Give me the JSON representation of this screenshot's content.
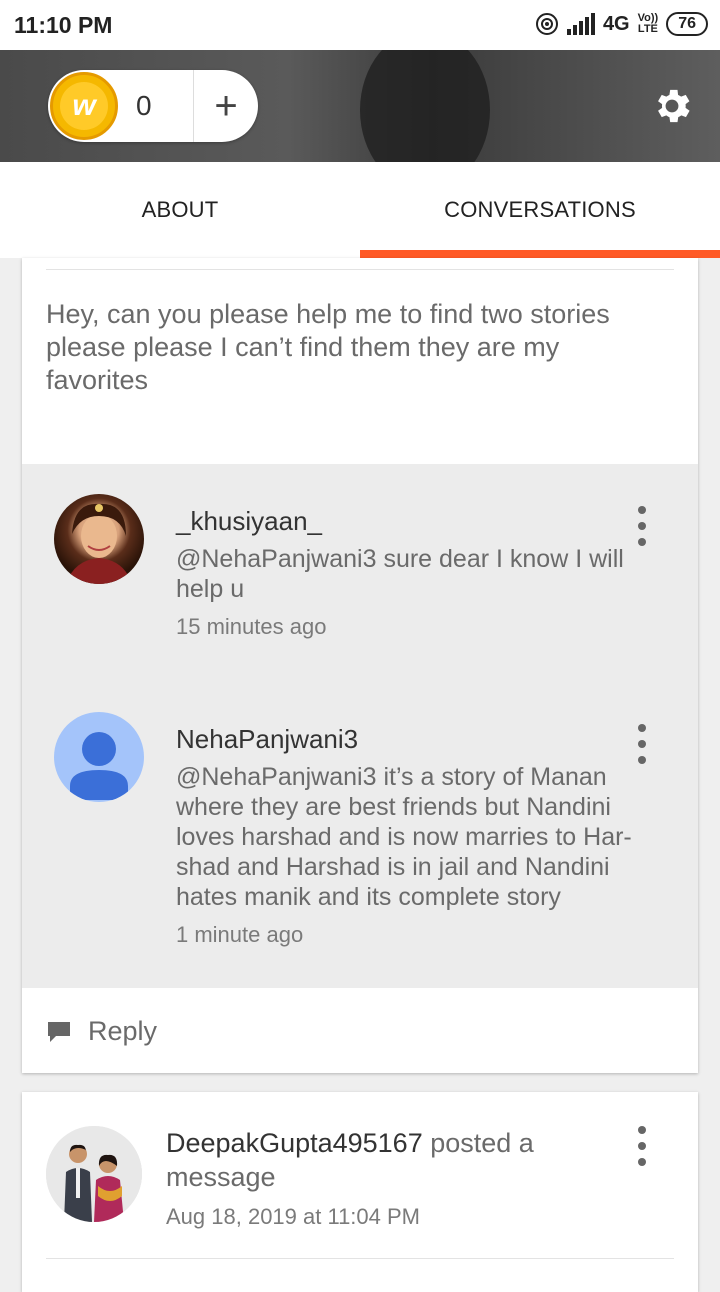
{
  "status_bar": {
    "time": "11:10 PM",
    "network": "4G",
    "volte_top": "Vo))",
    "volte_bottom": "LTE",
    "battery": "76"
  },
  "header": {
    "coin_count": "0",
    "add_label": "+",
    "coin_glyph": "w",
    "settings_icon": "gear-icon"
  },
  "tabs": [
    {
      "label": "ABOUT",
      "active": false
    },
    {
      "label": "CONVERSATIONS",
      "active": true
    }
  ],
  "colors": {
    "accent": "#ff5a26",
    "coin": "#f5b800"
  },
  "conversation": {
    "message": "Hey, can you please help me to find two stories please please I can’t find them they are my favorites",
    "replies": [
      {
        "name": "_khusiyaan_",
        "text": "@NehaPanjwani3 sure dear I know I will help u",
        "time": "15 minutes ago"
      },
      {
        "name": "NehaPanjwani3",
        "text": "@NehaPanjwani3 it’s a story of Manan where they are best friends but Nandini loves harshad and is now marries to Har-shad and Harshad is in jail and Nandini hates manik and its complete story",
        "time": "1 minute ago"
      }
    ],
    "reply_label": "Reply"
  },
  "post": {
    "author": "DeepakGupta495167",
    "verb": " posted a message",
    "time": "Aug 18, 2019 at 11:04 PM"
  }
}
